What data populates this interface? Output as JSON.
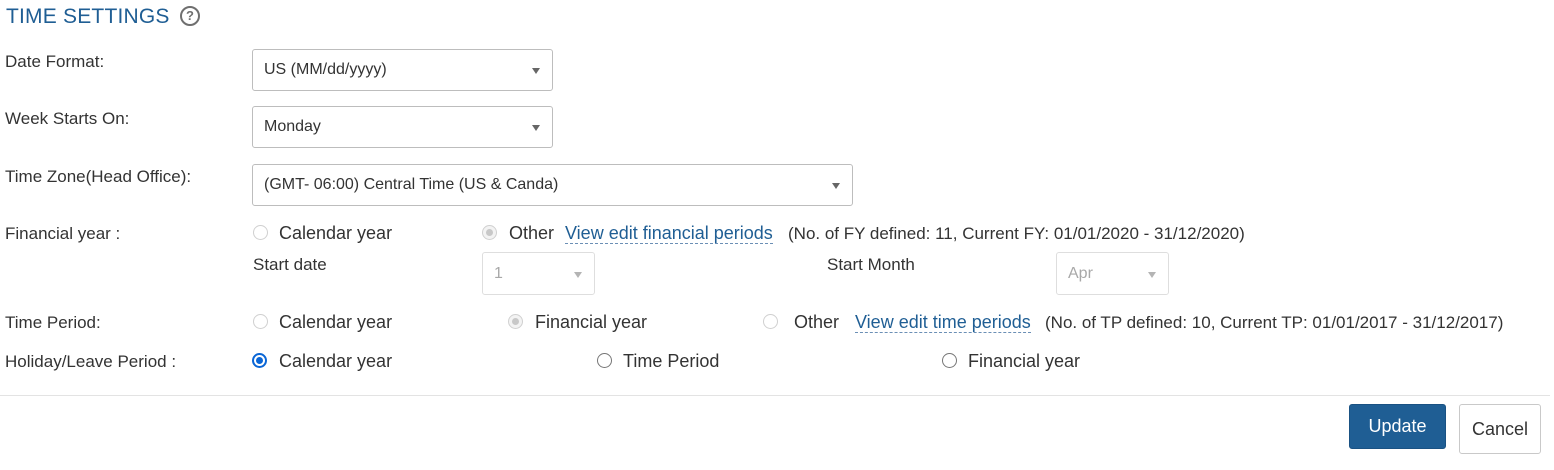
{
  "header": {
    "title": "TIME SETTINGS",
    "help_glyph": "?",
    "help_icon": "question-circle-icon"
  },
  "date_format": {
    "label": "Date Format:",
    "value": "US (MM/dd/yyyy)"
  },
  "week_starts": {
    "label": "Week Starts On:",
    "value": "Monday"
  },
  "time_zone": {
    "label": "Time Zone(Head Office):",
    "value": "(GMT- 06:00) Central Time (US & Canda)"
  },
  "financial_year": {
    "label": "Financial year :",
    "options": [
      "Calendar year",
      "Other"
    ],
    "selected": "Other",
    "link": "View edit financial periods",
    "note": "(No. of FY defined: 11,  Current FY: 01/01/2020 - 31/12/2020)",
    "start_date_label": "Start date",
    "start_date_value": "1",
    "start_month_label": "Start Month",
    "start_month_value": "Apr"
  },
  "time_period": {
    "label": "Time Period:",
    "options": [
      "Calendar year",
      "Financial year",
      "Other"
    ],
    "selected": "Financial year",
    "link": "View edit time periods",
    "note": "(No. of TP defined: 10,  Current TP: 01/01/2017 - 31/12/2017)"
  },
  "holiday_period": {
    "label": "Holiday/Leave Period :",
    "options": [
      "Calendar year",
      "Time Period",
      "Financial year"
    ],
    "selected": "Calendar year"
  },
  "actions": {
    "update": "Update",
    "cancel": "Cancel"
  },
  "colors": {
    "accent": "#1f5e94",
    "radio_selected": "#0a66d6"
  }
}
